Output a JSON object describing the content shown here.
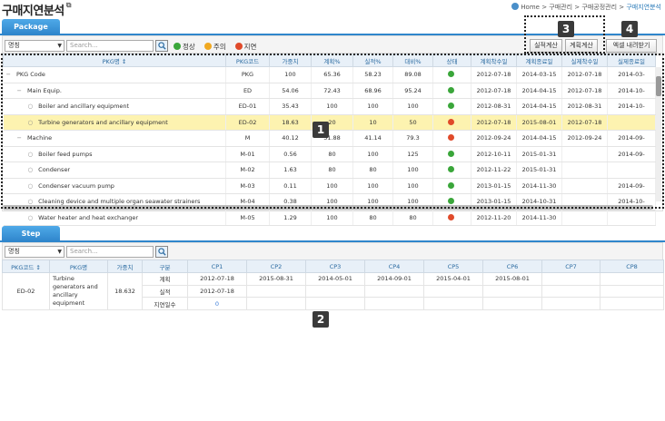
{
  "page": {
    "title": "구매지연분석",
    "ext_icon": "external-link-icon"
  },
  "breadcrumb": {
    "home": "Home",
    "sep1": " > ",
    "l1": "구매관리",
    "sep2": " > ",
    "l2": "구매공정관리",
    "sep3": " > ",
    "current": "구매지연분석"
  },
  "package_tab": {
    "label": "Package"
  },
  "step_tab": {
    "label": "Step"
  },
  "toolbar": {
    "select_value": "명칭",
    "search_placeholder": "Search...",
    "legend": [
      {
        "label": "정상",
        "color": "#3aa63a"
      },
      {
        "label": "주의",
        "color": "#f0a820"
      },
      {
        "label": "지연",
        "color": "#e04a2a"
      }
    ],
    "btn_actual": "실적계산",
    "btn_plan": "계획계산",
    "btn_excel": "엑셀 내려받기"
  },
  "package_table": {
    "headers": [
      "PKG명 ↕",
      "PKG코드",
      "가중치",
      "계획%",
      "실적%",
      "대비%",
      "상태",
      "계획착수일",
      "계획종료일",
      "실제착수일",
      "실제종료일"
    ],
    "rows": [
      {
        "indent": 0,
        "marker": "−",
        "name": "PKG Code",
        "code": "PKG",
        "weight": "100",
        "plan": "65.36",
        "actual": "58.23",
        "ratio": "89.08",
        "status": "#3aa63a",
        "ps": "2012-07-18",
        "pe": "2014-03-15",
        "as": "2012-07-18",
        "ae": "2014-03-"
      },
      {
        "indent": 1,
        "marker": "−",
        "name": "Main Equip.",
        "code": "ED",
        "weight": "54.06",
        "plan": "72.43",
        "actual": "68.96",
        "ratio": "95.24",
        "status": "#3aa63a",
        "ps": "2012-07-18",
        "pe": "2014-04-15",
        "as": "2012-07-18",
        "ae": "2014-10-"
      },
      {
        "indent": 2,
        "marker": "○",
        "name": "Boiler and ancillary equipment",
        "code": "ED-01",
        "weight": "35.43",
        "plan": "100",
        "actual": "100",
        "ratio": "100",
        "status": "#3aa63a",
        "ps": "2012-08-31",
        "pe": "2014-04-15",
        "as": "2012-08-31",
        "ae": "2014-10-"
      },
      {
        "indent": 2,
        "marker": "○",
        "name": "Turbine generators and ancillary equipment",
        "code": "ED-02",
        "weight": "18.63",
        "plan": "20",
        "actual": "10",
        "ratio": "50",
        "status": "#e04a2a",
        "ps": "2012-07-18",
        "pe": "2015-08-01",
        "as": "2012-07-18",
        "ae": "",
        "hl": true
      },
      {
        "indent": 1,
        "marker": "−",
        "name": "Machine",
        "code": "M",
        "weight": "40.12",
        "plan": "51.88",
        "actual": "41.14",
        "ratio": "79.3",
        "status": "#e04a2a",
        "ps": "2012-09-24",
        "pe": "2014-04-15",
        "as": "2012-09-24",
        "ae": "2014-09-"
      },
      {
        "indent": 2,
        "marker": "○",
        "name": "Boiler feed pumps",
        "code": "M-01",
        "weight": "0.56",
        "plan": "80",
        "actual": "100",
        "ratio": "125",
        "status": "#3aa63a",
        "ps": "2012-10-11",
        "pe": "2015-01-31",
        "as": "",
        "ae": "2014-09-"
      },
      {
        "indent": 2,
        "marker": "○",
        "name": "Condenser",
        "code": "M-02",
        "weight": "1.63",
        "plan": "80",
        "actual": "80",
        "ratio": "100",
        "status": "#3aa63a",
        "ps": "2012-11-22",
        "pe": "2015-01-31",
        "as": "",
        "ae": ""
      },
      {
        "indent": 2,
        "marker": "○",
        "name": "Condenser vacuum pump",
        "code": "M-03",
        "weight": "0.11",
        "plan": "100",
        "actual": "100",
        "ratio": "100",
        "status": "#3aa63a",
        "ps": "2013-01-15",
        "pe": "2014-11-30",
        "as": "",
        "ae": "2014-09-"
      },
      {
        "indent": 2,
        "marker": "○",
        "name": "Cleaning device and multiple organ seawater strainers",
        "code": "M-04",
        "weight": "0.38",
        "plan": "100",
        "actual": "100",
        "ratio": "100",
        "status": "#3aa63a",
        "ps": "2013-01-15",
        "pe": "2014-10-31",
        "as": "",
        "ae": "2014-10-"
      },
      {
        "indent": 2,
        "marker": "○",
        "name": "Water heater and heat exchanger",
        "code": "M-05",
        "weight": "1.29",
        "plan": "100",
        "actual": "80",
        "ratio": "80",
        "status": "#e04a2a",
        "ps": "2012-11-20",
        "pe": "2014-11-30",
        "as": "",
        "ae": ""
      }
    ]
  },
  "step_table": {
    "headers": [
      "PKG코드 ↕",
      "PKG명",
      "가중치",
      "구분",
      "CP1",
      "CP2",
      "CP3",
      "CP4",
      "CP5",
      "CP6",
      "CP7",
      "CP8"
    ],
    "code": "ED-02",
    "name": "Turbine generators and ancillary equipment",
    "weight": "18.632",
    "rows": [
      {
        "kind": "계획",
        "cps": [
          "2012-07-18",
          "2015-08-31",
          "2014-05-01",
          "2014-09-01",
          "2015-04-01",
          "2015-08-01",
          "",
          ""
        ]
      },
      {
        "kind": "실적",
        "cps": [
          "2012-07-18",
          "",
          "",
          "",
          "",
          "",
          "",
          ""
        ]
      },
      {
        "kind": "지연일수",
        "cps": [
          "0",
          "",
          "",
          "",
          "",
          "",
          "",
          ""
        ]
      }
    ]
  },
  "badges": [
    "1",
    "2",
    "3",
    "4"
  ]
}
